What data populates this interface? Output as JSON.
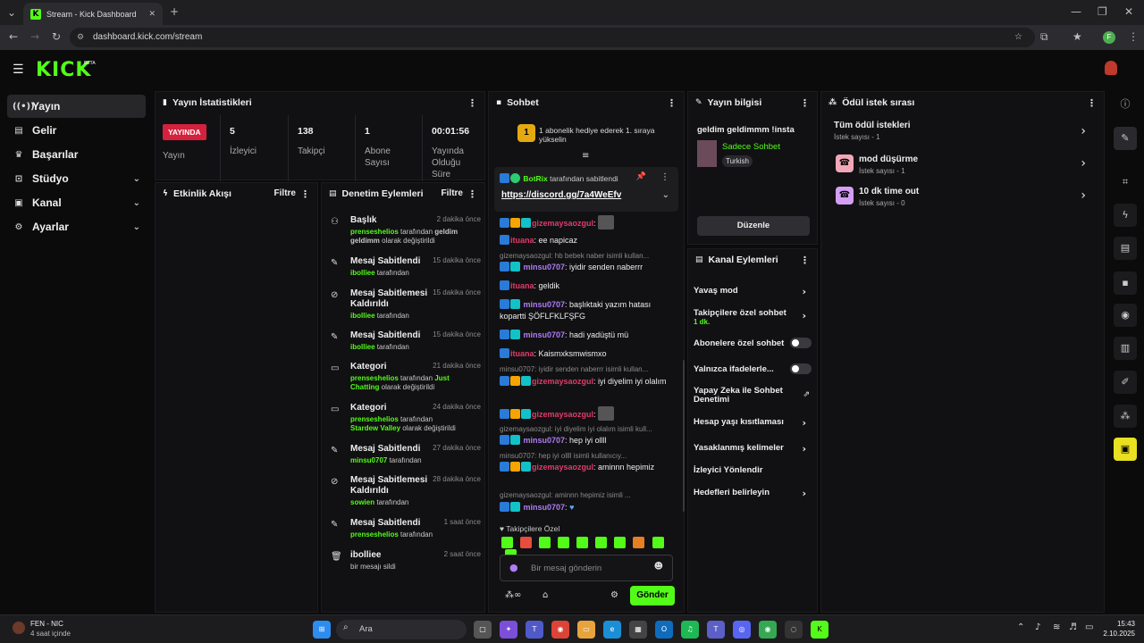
{
  "browser": {
    "tab_title": "Stream - Kick Dashboard",
    "url": "dashboard.kick.com/stream"
  },
  "app": {
    "logo": "KICK",
    "beta": "BETA"
  },
  "nav": {
    "items": [
      {
        "label": "Yayın",
        "icon": "broadcast-icon"
      },
      {
        "label": "Gelir",
        "icon": "chart-icon"
      },
      {
        "label": "Başarılar",
        "icon": "trophy-icon"
      },
      {
        "label": "Stüdyo",
        "icon": "studio-icon"
      },
      {
        "label": "Kanal",
        "icon": "channel-icon"
      },
      {
        "label": "Ayarlar",
        "icon": "gear-icon"
      }
    ]
  },
  "stats": {
    "title": "Yayın İstatistikleri",
    "live": "YAYINDA",
    "live_label": "Yayın",
    "viewers": "5",
    "viewers_label": "İzleyici",
    "followers": "138",
    "followers_label": "Takipçi",
    "subs": "1",
    "subs_label": "Abone Sayısı",
    "uptime": "00:01:56",
    "uptime_label": "Yayında Olduğu Süre"
  },
  "activity": {
    "title": "Etkinlik Akışı",
    "filter": "Filtre"
  },
  "modlog": {
    "title": "Denetim Eylemleri",
    "filter": "Filtre",
    "items": [
      {
        "title": "Başlık",
        "time": "2 dakika önce",
        "user": "prenseshelios",
        "mid": " tarafından ",
        "extra": "geldim geldimm",
        "tail": " olarak değiştirildi"
      },
      {
        "title": "Mesaj Sabitlendi",
        "time": "15 dakika önce",
        "user": "ibolliee",
        "mid": " tarafından",
        "extra": "",
        "tail": ""
      },
      {
        "title": "Mesaj Sabitlemesi Kaldırıldı",
        "time": "15 dakika önce",
        "user": "ibolliee",
        "mid": " tarafından",
        "extra": "",
        "tail": ""
      },
      {
        "title": "Mesaj Sabitlendi",
        "time": "15 dakika önce",
        "user": "ibolliee",
        "mid": " tarafından",
        "extra": "",
        "tail": ""
      },
      {
        "title": "Kategori",
        "time": "21 dakika önce",
        "user": "prenseshelios",
        "mid": " tarafından ",
        "extra": "Just Chatting",
        "tail": " olarak değiştirildi"
      },
      {
        "title": "Kategori",
        "time": "24 dakika önce",
        "user": "prenseshelios",
        "mid": " tarafından ",
        "extra": "Stardew Valley",
        "tail": " olarak değiştirildi"
      },
      {
        "title": "Mesaj Sabitlendi",
        "time": "27 dakika önce",
        "user": "minsu0707",
        "mid": " tarafından",
        "extra": "",
        "tail": ""
      },
      {
        "title": "Mesaj Sabitlemesi Kaldırıldı",
        "time": "28 dakika önce",
        "user": "sowien",
        "mid": " tarafından",
        "extra": "",
        "tail": ""
      },
      {
        "title": "Mesaj Sabitlendi",
        "time": "1 saat önce",
        "user": "prenseshelios",
        "mid": " tarafından",
        "extra": "",
        "tail": ""
      },
      {
        "title": "ibolliee",
        "time": "2 saat önce",
        "user": "",
        "mid": "bir mesajı sildi",
        "extra": "",
        "tail": ""
      }
    ]
  },
  "chat": {
    "title": "Sohbet",
    "gift_rank": "1",
    "gift_text": "1 abonelik hediye ederek 1. sıraya yükselin",
    "pinned_user": "BotRix",
    "pinned_by": " tarafından sabitlendi",
    "pinned_link": "https://discord.gg/7a4WeEfv",
    "messages": [
      {
        "user": "gizemaysaozgul",
        "text": ":"
      },
      {
        "user": "ituana",
        "text": ": ee napicaz"
      },
      {
        "reply": "gizemaysaozgul: hb bebek naber isimli kullan..."
      },
      {
        "user": "minsu0707",
        "text": ": iyidir senden naberrr"
      },
      {
        "user": "ituana",
        "text": ": geldik"
      },
      {
        "user": "minsu0707",
        "text": ": başlıktaki yazım hatası kopartti ŞÖFLFKLFŞFG"
      },
      {
        "user": "minsu0707",
        "text": ": hadi yadüştü mü"
      },
      {
        "user": "ituana",
        "text": ": Kaismxksmwismxo"
      },
      {
        "reply": "minsu0707: iyidir senden naberrr isimli kullan..."
      },
      {
        "user": "gizemaysaozgul",
        "text": ": iyi diyelim iyi olalım"
      },
      {
        "user": "gizemaysaozgul",
        "text": ":"
      },
      {
        "reply": "gizemaysaozgul: iyi diyelim iyi olalım isimli kull..."
      },
      {
        "user": "minsu0707",
        "text": ": hep iyi ollll"
      },
      {
        "reply": "minsu0707: hep iyi ollll isimli kullanıcıy..."
      },
      {
        "user": "gizemaysaozgul",
        "text": ": aminnn hepimiz"
      },
      {
        "reply": "gizemaysaozgul: aminnn hepimiz isimli ..."
      },
      {
        "user": "minsu0707",
        "text": ":"
      }
    ],
    "emote_title": "Takipçilere Özel",
    "input_placeholder": "Bir mesaj gönderin",
    "send": "Gönder"
  },
  "streaminfo": {
    "title": "Yayın bilgisi",
    "stream_title": "geldim geldimmm !insta",
    "category": "Sadece Sohbet",
    "language": "Turkish",
    "edit": "Düzenle"
  },
  "channelactions": {
    "title": "Kanal Eylemleri",
    "items": [
      {
        "label": "Yavaş mod",
        "sub": ""
      },
      {
        "label": "Takipçilere özel sohbet",
        "sub": "1 dk."
      },
      {
        "label": "Abonelere özel sohbet",
        "sub": ""
      },
      {
        "label": "Yalnızca ifadelerle...",
        "sub": ""
      },
      {
        "label": "Yapay Zeka ile Sohbet Denetimi",
        "sub": ""
      },
      {
        "label": "Hesap yaşı kısıtlaması",
        "sub": ""
      },
      {
        "label": "Yasaklanmış kelimeler",
        "sub": ""
      },
      {
        "label": "İzleyici Yönlendir",
        "sub": ""
      },
      {
        "label": "Hedefleri belirleyin",
        "sub": ""
      }
    ]
  },
  "rewards": {
    "title": "Ödül istek sırası",
    "items": [
      {
        "label": "Tüm ödül istekleri",
        "sub": "İstek sayısı - 1"
      },
      {
        "label": "mod düşürme",
        "sub": "İstek sayısı - 1"
      },
      {
        "label": "10 dk time out",
        "sub": "İstek sayısı - 0"
      }
    ]
  },
  "taskbar": {
    "weather_title": "FEN - NIC",
    "weather_sub": "4 saat içinde",
    "search": "Ara",
    "time": "15:43",
    "date": "2.10.2025"
  }
}
